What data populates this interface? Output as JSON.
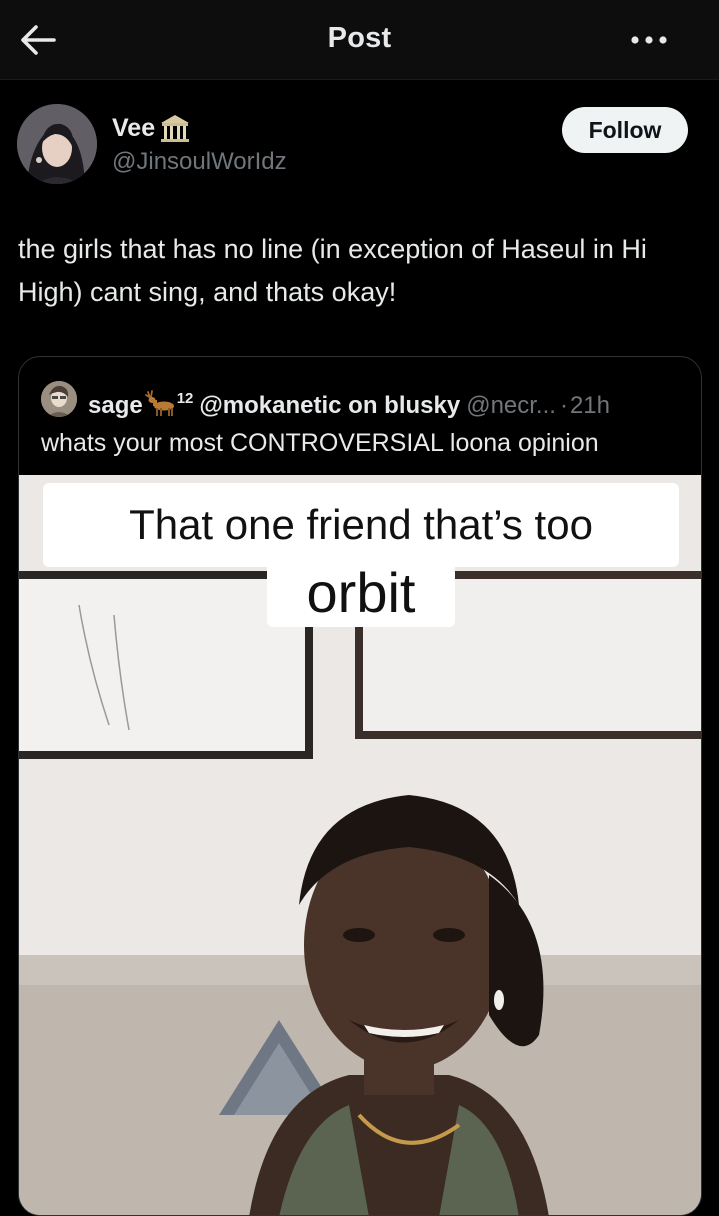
{
  "topbar": {
    "title": "Post",
    "back_icon": "arrow-left-icon",
    "more_icon": "more-horizontal-icon"
  },
  "author": {
    "name": "Vee",
    "handle": "@JinsoulWorIdz",
    "badge_icon": "classical-building-icon",
    "follow_label": "Follow"
  },
  "post": {
    "text": "the girls that has no line (in exception of Haseul in Hi High) cant sing, and thats okay!"
  },
  "quote": {
    "name": "sage",
    "emoji": "deer-icon",
    "superscript": "12",
    "name_rest": "@mokanetic on blusky",
    "handle": "@necr...",
    "separator": "·",
    "time": "21h",
    "text": "whats your most CONTROVERSIAL loona opinion",
    "media": {
      "caption_line1": "That one friend that’s too",
      "caption_line2": "orbit"
    }
  },
  "colors": {
    "background": "#000000",
    "text_primary": "#e7e9ea",
    "text_secondary": "#71767b",
    "follow_bg": "#eff3f4",
    "border": "#2f3336"
  }
}
